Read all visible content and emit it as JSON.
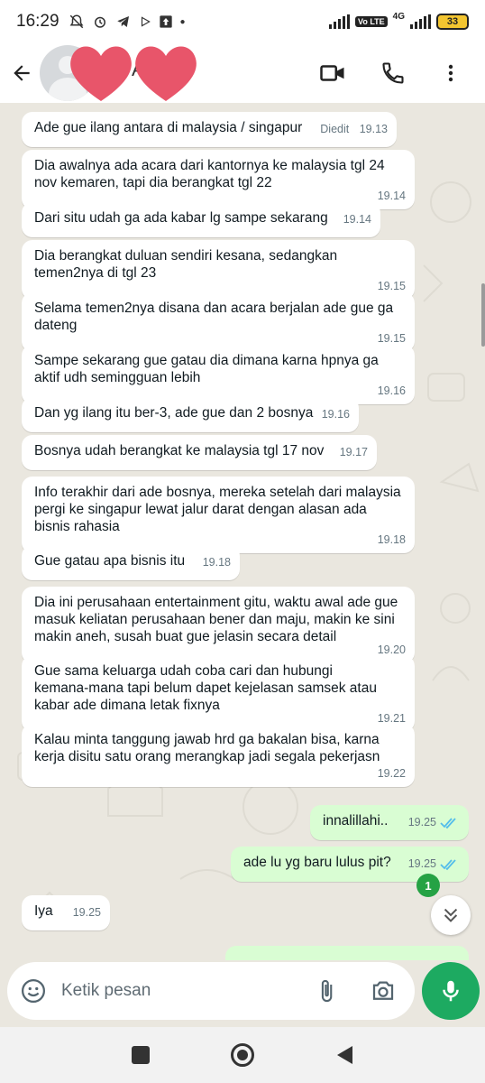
{
  "status_bar": {
    "time": "16:29",
    "network_label": "4G",
    "volte_label": "Vo LTE",
    "battery": "33"
  },
  "header": {
    "contact_initial": "A",
    "icons": [
      "back-arrow-icon",
      "video-call-icon",
      "phone-icon",
      "more-vert-icon"
    ]
  },
  "messages": [
    {
      "direction": "in",
      "text": "Ade gue ilang antara di malaysia / singapur",
      "time": "19.13",
      "edited": "Diedit"
    },
    {
      "direction": "in",
      "text": "Dia awalnya ada acara dari kantornya ke malaysia tgl 24\nnov kemaren, tapi dia berangkat tgl 22",
      "time": "19.14"
    },
    {
      "direction": "in",
      "text": "Dari situ udah ga ada kabar lg sampe sekarang",
      "time": "19.14"
    },
    {
      "direction": "in",
      "text": "Dia berangkat duluan sendiri kesana, sedangkan\ntemen2nya di tgl 23",
      "time": "19.15"
    },
    {
      "direction": "in",
      "text": "Selama temen2nya disana dan acara berjalan ade gue ga\ndateng",
      "time": "19.15"
    },
    {
      "direction": "in",
      "text": "Sampe sekarang gue gatau dia dimana karna hpnya ga\naktif udh semingguan lebih",
      "time": "19.16"
    },
    {
      "direction": "in",
      "text": "Dan yg ilang itu ber-3, ade gue dan 2 bosnya",
      "time": "19.16"
    },
    {
      "direction": "in",
      "text": "Bosnya udah berangkat ke malaysia tgl 17 nov",
      "time": "19.17"
    },
    {
      "direction": "in",
      "text": "Info terakhir dari ade bosnya, mereka setelah dari malaysia\npergi ke singapur lewat jalur darat dengan alasan ada\nbisnis rahasia",
      "time": "19.18"
    },
    {
      "direction": "in",
      "text": "Gue gatau apa bisnis itu",
      "time": "19.18"
    },
    {
      "direction": "in",
      "text": "Dia ini perusahaan entertainment gitu, waktu awal ade gue\nmasuk keliatan perusahaan bener dan maju, makin ke sini\nmakin aneh, susah buat gue jelasin secara detail",
      "time": "19.20"
    },
    {
      "direction": "in",
      "text": "Gue sama keluarga udah coba cari dan hubungi\nkemana-mana tapi belum dapet kejelasan samsek atau\nkabar ade dimana letak fixnya",
      "time": "19.21"
    },
    {
      "direction": "in",
      "text": "Kalau minta tanggung jawab hrd ga bakalan bisa, karna\nkerja disitu satu orang merangkap jadi segala pekerjasn",
      "time": "19.22"
    },
    {
      "direction": "out",
      "text": "innalillahi..",
      "time": "19.25",
      "status": "read"
    },
    {
      "direction": "out",
      "text": "ade lu yg baru lulus pit?",
      "time": "19.25",
      "status": "read"
    },
    {
      "direction": "in",
      "text": "Iya",
      "time": "19.25"
    }
  ],
  "unread_count": "1",
  "input": {
    "placeholder": "Ketik pesan"
  },
  "colors": {
    "incoming_bubble": "#ffffff",
    "outgoing_bubble": "#d9fdd3",
    "accent": "#1daa61",
    "read_ticks": "#53bdeb",
    "chat_bg": "#eae7df"
  }
}
